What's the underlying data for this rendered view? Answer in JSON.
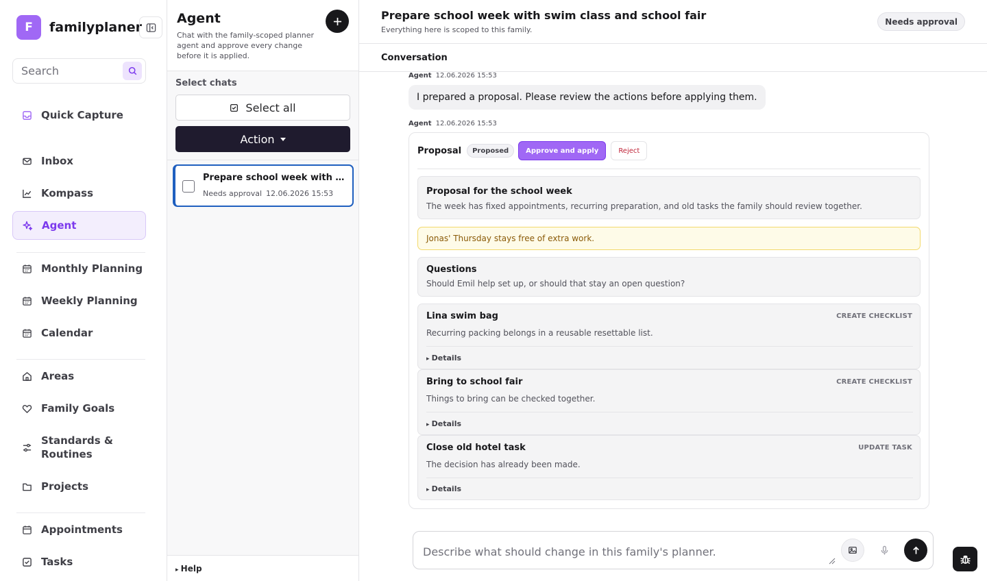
{
  "app": {
    "logo_letter": "F",
    "name": "familyplaner"
  },
  "search": {
    "placeholder": "Search"
  },
  "nav": {
    "quick_capture": "Quick Capture",
    "inbox": "Inbox",
    "kompass": "Kompass",
    "agent": "Agent",
    "monthly": "Monthly Planning",
    "weekly": "Weekly Planning",
    "calendar": "Calendar",
    "areas": "Areas",
    "goals": "Family Goals",
    "standards_line1": "Standards &",
    "standards_line2": "Routines",
    "projects": "Projects",
    "appointments": "Appointments",
    "tasks": "Tasks"
  },
  "chats": {
    "title": "Agent",
    "description": "Chat with the family-scoped planner agent and approve every change before it is applied.",
    "select_label": "Select chats",
    "select_all": "Select all",
    "action": "Action",
    "items": [
      {
        "title": "Prepare school week with swim class and school fair",
        "status": "Needs approval",
        "time": "12.06.2026 15:53"
      }
    ],
    "help": "Help"
  },
  "main": {
    "title": "Prepare school week with swim class and school fair",
    "subtitle": "Everything here is scoped to this family.",
    "status": "Needs approval",
    "conversation_label": "Conversation",
    "messages": [
      {
        "author": "Agent",
        "time": "12.06.2026 15:53",
        "text": "I prepared a proposal. Please review the actions before applying them."
      },
      {
        "author": "Agent",
        "time": "12.06.2026 15:53"
      }
    ],
    "proposal": {
      "title": "Proposal",
      "status": "Proposed",
      "approve": "Approve and apply",
      "reject": "Reject",
      "summary_title": "Proposal for the school week",
      "summary_text": "The week has fixed appointments, recurring preparation, and old tasks the family should review together.",
      "note": "Jonas' Thursday stays free of extra work.",
      "questions_title": "Questions",
      "questions_text": "Should Emil help set up, or should that stay an open question?",
      "actions": [
        {
          "title": "Lina swim bag",
          "kind": "CREATE CHECKLIST",
          "text": "Recurring packing belongs in a reusable resettable list.",
          "details": "Details"
        },
        {
          "title": "Bring to school fair",
          "kind": "CREATE CHECKLIST",
          "text": "Things to bring can be checked together.",
          "details": "Details"
        },
        {
          "title": "Close old hotel task",
          "kind": "UPDATE TASK",
          "text": "The decision has already been made.",
          "details": "Details"
        }
      ]
    },
    "composer": {
      "placeholder": "Describe what should change in this family's planner."
    }
  },
  "colors": {
    "accent": "#a068f5",
    "accent_dark": "#7c3aed",
    "selected_border": "#1f5fbf",
    "dark": "#18181b",
    "reject": "#c0263a"
  }
}
